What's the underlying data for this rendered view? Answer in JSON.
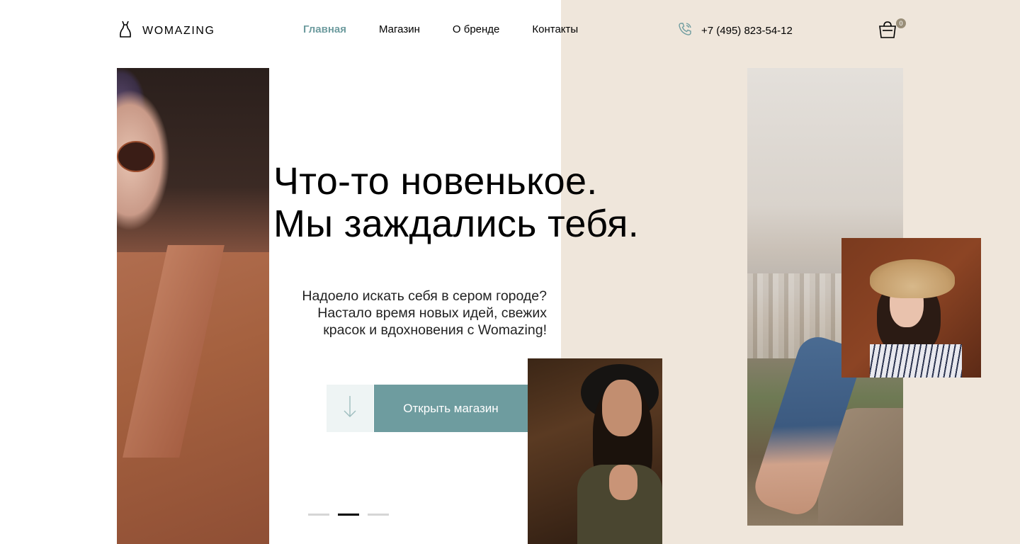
{
  "header": {
    "logo_text": "WOMAZING",
    "nav": [
      {
        "label": "Главная",
        "active": true
      },
      {
        "label": "Магазин",
        "active": false
      },
      {
        "label": "О бренде",
        "active": false
      },
      {
        "label": "Контакты",
        "active": false
      }
    ],
    "phone": "+7 (495) 823-54-12",
    "cart_count": "0"
  },
  "hero": {
    "title_line1": "Что-то новенькое.",
    "title_line2": "Мы заждались тебя.",
    "subtitle_line1": "Надоело искать себя в сером городе?",
    "subtitle_line2": "Настало время новых идей, свежих",
    "subtitle_line3": "красок и вдохновения с Womazing!",
    "cta_label": "Открыть магазин"
  },
  "slider": {
    "total": 3,
    "active_index": 1
  },
  "colors": {
    "accent": "#6E9C9F",
    "beige": "#EFE6DB",
    "arrow_bg": "#EEF4F4",
    "badge": "#998E78"
  },
  "icons": [
    "dress-logo-icon",
    "phone-icon",
    "cart-icon",
    "arrow-down-icon"
  ]
}
